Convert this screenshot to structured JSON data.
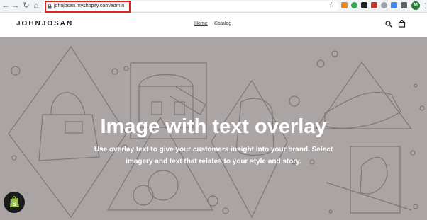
{
  "browser": {
    "url": "johnjosan.myshopify.com/admin",
    "avatar_initial": "M",
    "highlight_color": "#e2231a",
    "icons": [
      "back-arrow-icon",
      "forward-arrow-icon",
      "reload-icon",
      "home-icon",
      "lock-icon",
      "bookmark-star-icon",
      "menu-dots-icon"
    ]
  },
  "store": {
    "logo": "JOHNJOSAN",
    "nav": [
      {
        "label": "Home",
        "active": true
      },
      {
        "label": "Catalog",
        "active": false
      }
    ],
    "icons": [
      "search-icon",
      "cart-icon"
    ]
  },
  "hero": {
    "title": "Image with text overlay",
    "subtitle": "Use overlay text to give your customers insight into your brand. Select imagery and text that relates to your style and story.",
    "background_color": "#aaa4a4"
  },
  "colors": {
    "shopify_badge": "#1c1c1c",
    "shopify_green": "#95bf47"
  }
}
